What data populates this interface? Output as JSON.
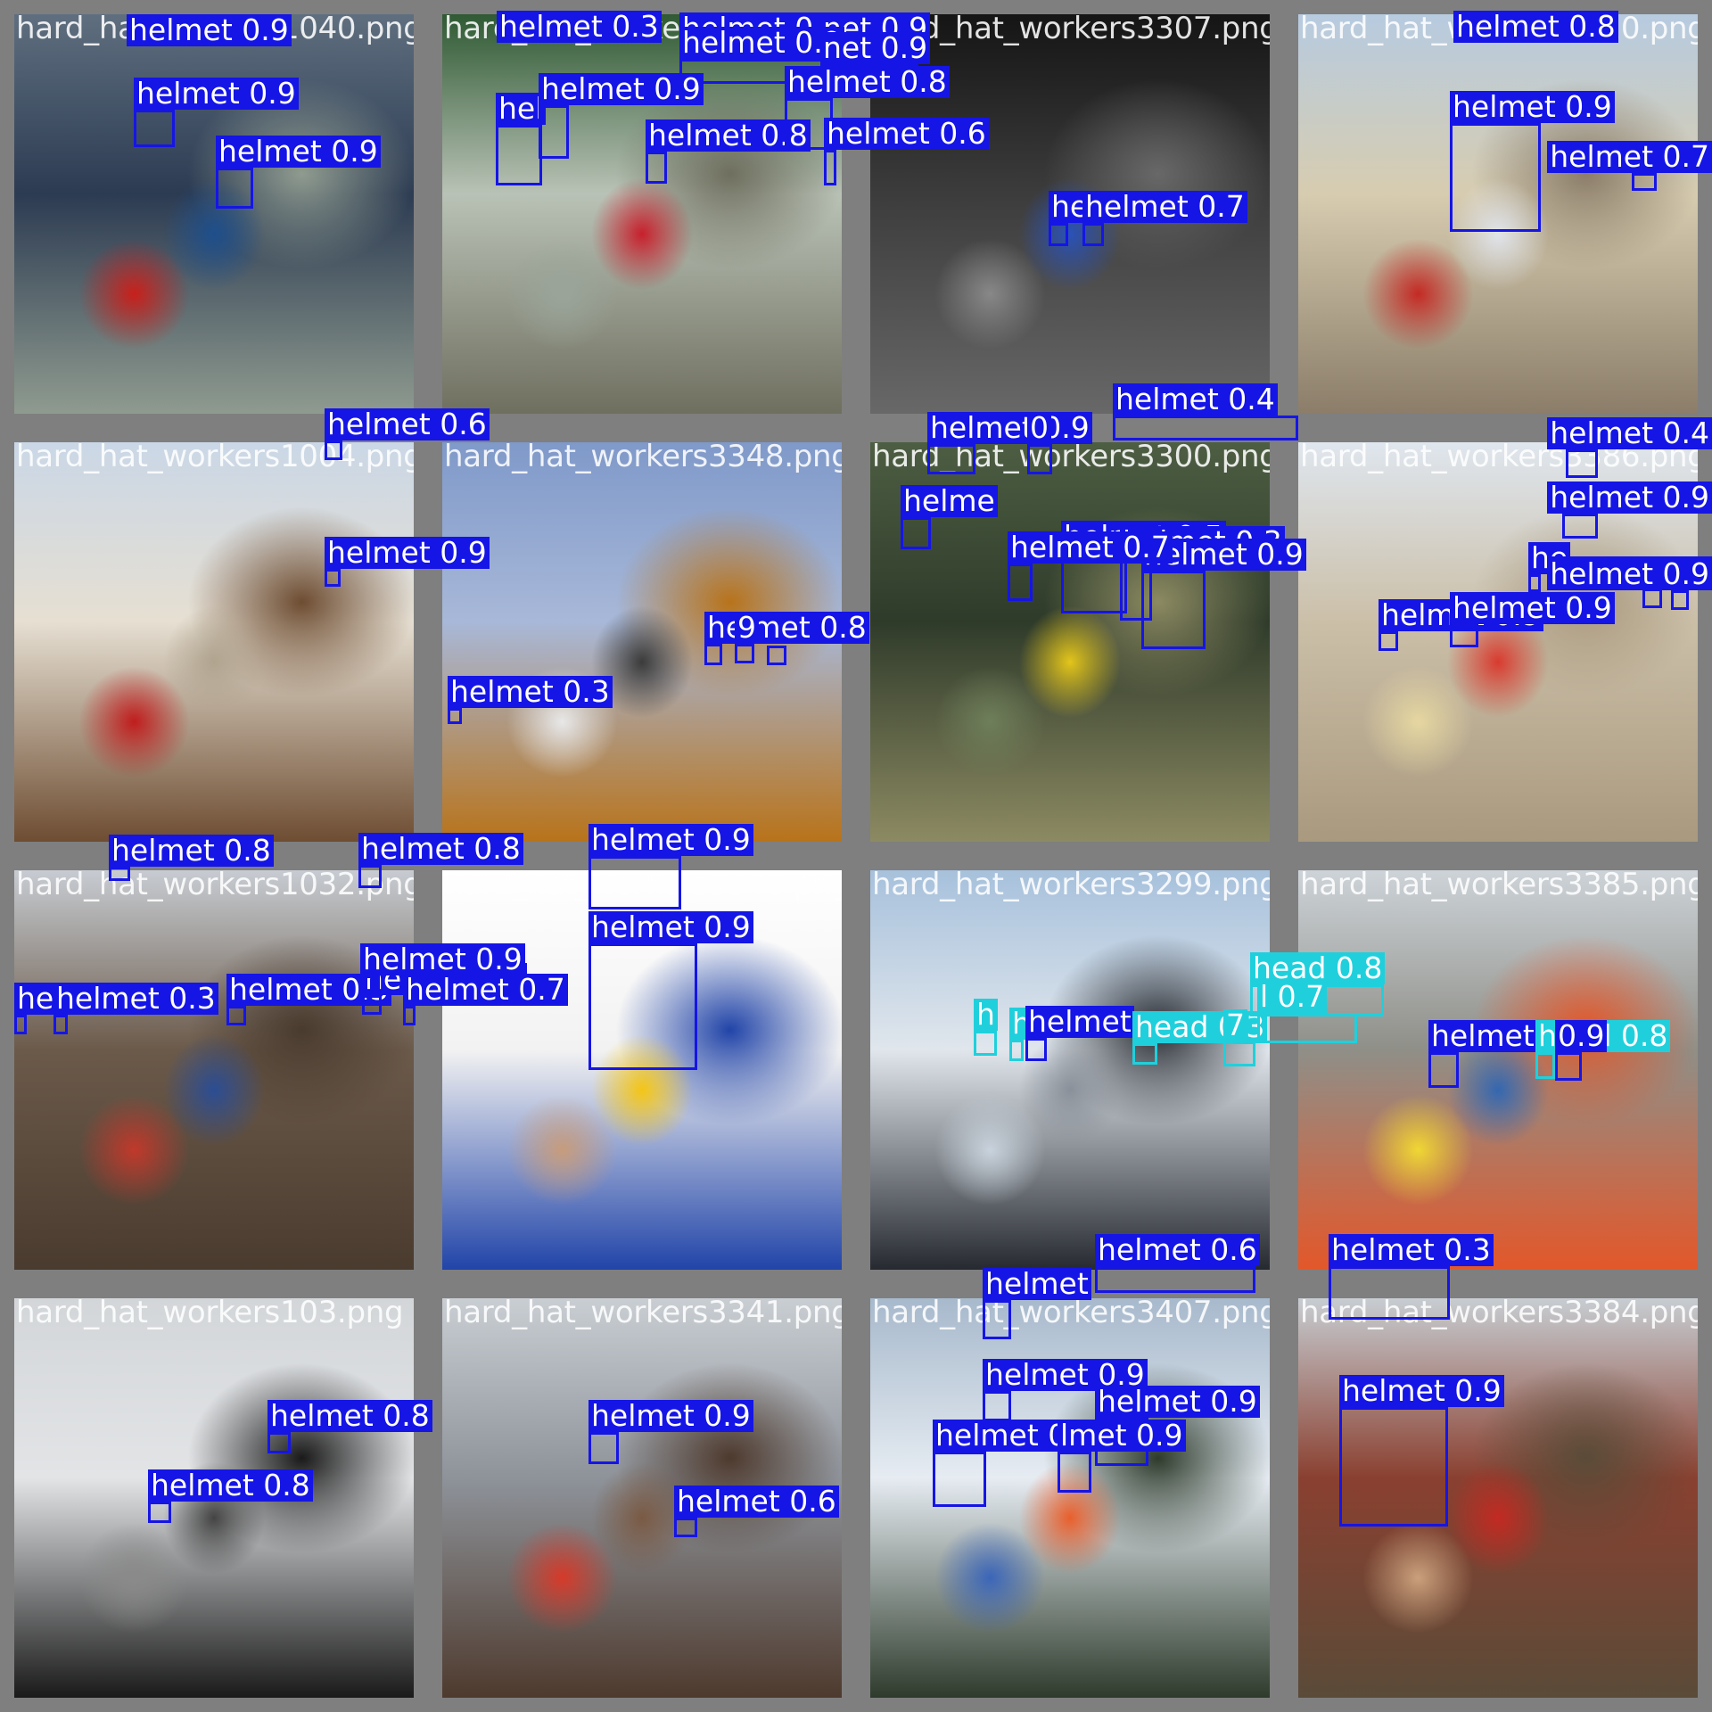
{
  "colors": {
    "helmet": "#1515e6",
    "head": "#1fd0dc",
    "frame": "#7f7f7f"
  },
  "tiles": [
    {
      "file": "hard_hat_workers1040.png",
      "scene": [
        "#5f6f7f",
        "#2c3b52",
        "#8f9b8f",
        "#1e4f8c",
        "#c8201b"
      ]
    },
    {
      "file": "hard_hat_workers1031.png",
      "scene": [
        "#2f5a33",
        "#b9c2b6",
        "#6f6f5f",
        "#c7202c",
        "#9aa59a"
      ]
    },
    {
      "file": "hard_hat_workers3307.png",
      "scene": [
        "#151515",
        "#3c3c3c",
        "#686868",
        "#2a52b8",
        "#888888"
      ]
    },
    {
      "file": "hard_hat_workers3310.png",
      "scene": [
        "#b7cbe0",
        "#d7ccb0",
        "#8b7d69",
        "#dfe3ea",
        "#c42a24"
      ]
    },
    {
      "file": "hard_hat_workers1004.png",
      "scene": [
        "#cad7e6",
        "#e6dfd2",
        "#6e4d32",
        "#b0a48f",
        "#c01d1d"
      ]
    },
    {
      "file": "hard_hat_workers3348.png",
      "scene": [
        "#7f99c9",
        "#a8b8d8",
        "#b8731a",
        "#3b3b3b",
        "#e8e8e8"
      ]
    },
    {
      "file": "hard_hat_workers3300.png",
      "scene": [
        "#4d5e43",
        "#2f3b2a",
        "#8c8a62",
        "#e3c51b",
        "#6e7e5a"
      ]
    },
    {
      "file": "hard_hat_workers3386.png",
      "scene": [
        "#dfe6ee",
        "#cbbfa8",
        "#a9997e",
        "#d83b2f",
        "#e6d7a1"
      ]
    },
    {
      "file": "hard_hat_workers1032.png",
      "scene": [
        "#c7ccd2",
        "#6b5a4a",
        "#4a3b2f",
        "#2b4d93",
        "#c0392b"
      ]
    },
    {
      "file": "hard_hat_workers3346.png",
      "scene": [
        "#ffffff",
        "#f2f2f2",
        "#2144a8",
        "#f3c516",
        "#c79c7c"
      ]
    },
    {
      "file": "hard_hat_workers3299.png",
      "scene": [
        "#a7c1dc",
        "#e0e6ec",
        "#262a30",
        "#8a9099",
        "#c9d3dd"
      ]
    },
    {
      "file": "hard_hat_workers3385.png",
      "scene": [
        "#cdd3d8",
        "#8f8f88",
        "#e3572a",
        "#3467b0",
        "#f0d733"
      ]
    },
    {
      "file": "hard_hat_workers103.png",
      "scene": [
        "#d3d6d9",
        "#e2e4e6",
        "#1a1a1a",
        "#444444",
        "#8a8a8a"
      ]
    },
    {
      "file": "hard_hat_workers3341.png",
      "scene": [
        "#c9ced3",
        "#8e939a",
        "#4e3a2e",
        "#7a5a44",
        "#d63a2a"
      ]
    },
    {
      "file": "hard_hat_workers3407.png",
      "scene": [
        "#a7b9cc",
        "#e6ecf2",
        "#2e3b2c",
        "#e85f2c",
        "#3b66b8"
      ]
    },
    {
      "file": "hard_hat_workers3384.png",
      "scene": [
        "#c7cdd2",
        "#8a4030",
        "#5a4b38",
        "#c22a22",
        "#caa07c"
      ]
    }
  ],
  "detections": [
    {
      "tile": 0,
      "cls": "helmet",
      "label": "helmet 0.9",
      "b": [
        142,
        16,
        174,
        28
      ]
    },
    {
      "tile": 0,
      "cls": "helmet",
      "label": "helmet 0.9",
      "b": [
        150,
        123,
        46,
        42
      ]
    },
    {
      "tile": 0,
      "cls": "helmet",
      "label": "helmet 0.9",
      "b": [
        242,
        188,
        42,
        46
      ]
    },
    {
      "tile": 1,
      "cls": "helmet",
      "label": "helmet 0.3",
      "b": [
        557,
        12,
        180,
        28
      ]
    },
    {
      "tile": 1,
      "cls": "helmet",
      "label": "helmet 0.9",
      "b": [
        762,
        14,
        174,
        28
      ]
    },
    {
      "tile": 1,
      "cls": "helmet",
      "label": "net 0.9",
      "b": [
        920,
        14,
        110,
        28
      ]
    },
    {
      "tile": 1,
      "cls": "helmet",
      "label": "helmet 0.9",
      "b": [
        762,
        66,
        174,
        28
      ]
    },
    {
      "tile": 1,
      "cls": "helmet",
      "label": "net 0.9",
      "b": [
        920,
        72,
        110,
        28
      ]
    },
    {
      "tile": 1,
      "cls": "helmet",
      "label": "hel",
      "b": [
        556,
        140,
        52,
        68
      ]
    },
    {
      "tile": 1,
      "cls": "helmet",
      "label": "helmet 0.9",
      "b": [
        604,
        118,
        34,
        60
      ]
    },
    {
      "tile": 1,
      "cls": "helmet",
      "label": "helmet 0.8",
      "b": [
        724,
        170,
        24,
        36
      ]
    },
    {
      "tile": 1,
      "cls": "helmet",
      "label": "helmet 0.8",
      "b": [
        880,
        110,
        54,
        58
      ]
    },
    {
      "tile": 2,
      "cls": "helmet",
      "label": "helmet 0.6",
      "b": [
        924,
        168,
        14,
        40
      ]
    },
    {
      "tile": 2,
      "cls": "helmet",
      "label": "he",
      "b": [
        1176,
        250,
        22,
        26
      ]
    },
    {
      "tile": 2,
      "cls": "helmet",
      "label": "helmet 0.7",
      "b": [
        1214,
        250,
        24,
        26
      ]
    },
    {
      "tile": 3,
      "cls": "helmet",
      "label": "helmet 0.8",
      "b": [
        1630,
        12,
        180,
        28
      ]
    },
    {
      "tile": 3,
      "cls": "helmet",
      "label": "helmet 0.9",
      "b": [
        1626,
        138,
        102,
        122
      ]
    },
    {
      "tile": 3,
      "cls": "helmet",
      "label": "helmet 0.7",
      "b": [
        1830,
        194,
        28,
        20
      ]
    },
    {
      "tile": 4,
      "cls": "helmet",
      "label": "helmet 0.6",
      "b": [
        364,
        494,
        20,
        22
      ]
    },
    {
      "tile": 4,
      "cls": "helmet",
      "label": "helmet 0.9",
      "b": [
        364,
        638,
        18,
        20
      ]
    },
    {
      "tile": 5,
      "cls": "helmet",
      "label": "helmet 0.3",
      "b": [
        502,
        794,
        16,
        18
      ]
    },
    {
      "tile": 5,
      "cls": "helmet",
      "label": "helmet 0.8",
      "b": [
        790,
        722,
        20,
        24
      ]
    },
    {
      "tile": 5,
      "cls": "helmet",
      "label": "9",
      "b": [
        824,
        722,
        22,
        22
      ]
    },
    {
      "tile": 5,
      "cls": "helmet",
      "label": "",
      "b": [
        860,
        724,
        22,
        22
      ]
    },
    {
      "tile": 6,
      "cls": "helmet",
      "label": "helmet 0.9",
      "b": [
        1040,
        498,
        54,
        34
      ]
    },
    {
      "tile": 6,
      "cls": "helmet",
      "label": "0",
      "b": [
        1152,
        498,
        28,
        34
      ]
    },
    {
      "tile": 6,
      "cls": "helmet",
      "label": "helmet 0.4",
      "b": [
        1248,
        466,
        208,
        28
      ]
    },
    {
      "tile": 6,
      "cls": "helmet",
      "label": "helme",
      "b": [
        1010,
        580,
        34,
        36
      ]
    },
    {
      "tile": 6,
      "cls": "helmet",
      "label": "helmet 0.5",
      "b": [
        1190,
        620,
        74,
        68
      ]
    },
    {
      "tile": 6,
      "cls": "helmet",
      "label": "helmet 0.3",
      "b": [
        1256,
        626,
        36,
        70
      ]
    },
    {
      "tile": 6,
      "cls": "helmet",
      "label": "helmet 0.9",
      "b": [
        1280,
        640,
        72,
        88
      ]
    },
    {
      "tile": 6,
      "cls": "helmet",
      "label": "helmet 0.7",
      "b": [
        1130,
        632,
        28,
        42
      ]
    },
    {
      "tile": 7,
      "cls": "helmet",
      "label": "helmet 0.4",
      "b": [
        1756,
        504,
        36,
        32
      ]
    },
    {
      "tile": 7,
      "cls": "helmet",
      "label": "helmet 0.9",
      "b": [
        1752,
        576,
        40,
        28
      ]
    },
    {
      "tile": 7,
      "cls": "helmet",
      "label": "he",
      "b": [
        1714,
        644,
        14,
        20
      ]
    },
    {
      "tile": 7,
      "cls": "helmet",
      "label": "helmet 0.7",
      "b": [
        1842,
        660,
        22,
        22
      ]
    },
    {
      "tile": 7,
      "cls": "helmet",
      "label": "helmet 0.9",
      "b": [
        1546,
        708,
        22,
        22
      ]
    },
    {
      "tile": 7,
      "cls": "helmet",
      "label": "helmet 0.9",
      "b": [
        1626,
        700,
        32,
        26
      ]
    },
    {
      "tile": 7,
      "cls": "helmet",
      "label": "helmet 0.9",
      "b": [
        1874,
        662,
        20,
        22
      ]
    },
    {
      "tile": 8,
      "cls": "helmet",
      "label": "helmet 0.8",
      "b": [
        122,
        972,
        24,
        16
      ]
    },
    {
      "tile": 8,
      "cls": "helmet",
      "label": "helmet 0.8",
      "b": [
        402,
        970,
        26,
        26
      ]
    },
    {
      "tile": 8,
      "cls": "helmet",
      "label": "helmet 0.3",
      "b": [
        254,
        1128,
        22,
        22
      ]
    },
    {
      "tile": 8,
      "cls": "helmet",
      "label": "he",
      "b": [
        16,
        1138,
        14,
        22
      ]
    },
    {
      "tile": 8,
      "cls": "helmet",
      "label": "helmet 0.3",
      "b": [
        60,
        1138,
        16,
        22
      ]
    },
    {
      "tile": 8,
      "cls": "helmet",
      "label": "helmet 0.8",
      "b": [
        406,
        1116,
        22,
        22
      ]
    },
    {
      "tile": 8,
      "cls": "helmet",
      "label": "helmet 0.9",
      "b": [
        404,
        1094,
        22,
        22
      ]
    },
    {
      "tile": 8,
      "cls": "helmet",
      "label": "helmet 0.7",
      "b": [
        452,
        1128,
        14,
        22
      ]
    },
    {
      "tile": 9,
      "cls": "helmet",
      "label": "helmet 0.9",
      "b": [
        660,
        960,
        104,
        60
      ]
    },
    {
      "tile": 9,
      "cls": "helmet",
      "label": "helmet 0.9",
      "b": [
        660,
        1058,
        122,
        142
      ]
    },
    {
      "tile": 10,
      "cls": "head",
      "label": "h",
      "b": [
        1092,
        1156,
        26,
        28
      ]
    },
    {
      "tile": 10,
      "cls": "head",
      "label": "h",
      "b": [
        1132,
        1166,
        16,
        24
      ]
    },
    {
      "tile": 10,
      "cls": "helmet",
      "label": "helmet",
      "b": [
        1150,
        1164,
        24,
        26
      ]
    },
    {
      "tile": 10,
      "cls": "head",
      "label": "head 0.3",
      "b": [
        1270,
        1170,
        28,
        24
      ]
    },
    {
      "tile": 10,
      "cls": "head",
      "label": "7",
      "b": [
        1372,
        1168,
        36,
        28
      ]
    },
    {
      "tile": 10,
      "cls": "head",
      "label": "head 0.8",
      "b": [
        1402,
        1104,
        150,
        36
      ]
    },
    {
      "tile": 10,
      "cls": "head",
      "label": "l 0.7",
      "b": [
        1410,
        1136,
        112,
        34
      ]
    },
    {
      "tile": 11,
      "cls": "helmet",
      "label": "helmet",
      "b": [
        1602,
        1180,
        34,
        40
      ]
    },
    {
      "tile": 11,
      "cls": "head",
      "label": "head 0.8",
      "b": [
        1722,
        1180,
        22,
        30
      ]
    },
    {
      "tile": 11,
      "cls": "helmet",
      "label": "0.9",
      "b": [
        1744,
        1180,
        30,
        32
      ]
    },
    {
      "tile": 12,
      "cls": "helmet",
      "label": "helmet 0.8",
      "b": [
        300,
        1606,
        26,
        24
      ]
    },
    {
      "tile": 12,
      "cls": "helmet",
      "label": "helmet 0.8",
      "b": [
        166,
        1684,
        26,
        24
      ]
    },
    {
      "tile": 13,
      "cls": "helmet",
      "label": "helmet 0.9",
      "b": [
        660,
        1606,
        34,
        36
      ]
    },
    {
      "tile": 13,
      "cls": "helmet",
      "label": "helmet 0.6",
      "b": [
        756,
        1702,
        26,
        22
      ]
    },
    {
      "tile": 14,
      "cls": "helmet",
      "label": "helmet",
      "b": [
        1102,
        1458,
        32,
        44
      ]
    },
    {
      "tile": 14,
      "cls": "helmet",
      "label": "helmet 0.6",
      "b": [
        1228,
        1420,
        180,
        30
      ]
    },
    {
      "tile": 14,
      "cls": "helmet",
      "label": "helmet 0.9",
      "b": [
        1102,
        1560,
        32,
        34
      ]
    },
    {
      "tile": 14,
      "cls": "helmet",
      "label": "helmet 0.9",
      "b": [
        1228,
        1590,
        60,
        54
      ]
    },
    {
      "tile": 14,
      "cls": "helmet",
      "label": "helmet 0.7",
      "b": [
        1046,
        1628,
        60,
        62
      ]
    },
    {
      "tile": 14,
      "cls": "helmet",
      "label": "lmet 0.9",
      "b": [
        1186,
        1628,
        38,
        46
      ]
    },
    {
      "tile": 15,
      "cls": "helmet",
      "label": "helmet 0.3",
      "b": [
        1490,
        1420,
        136,
        60
      ]
    },
    {
      "tile": 15,
      "cls": "helmet",
      "label": "helmet 0.9",
      "b": [
        1502,
        1578,
        122,
        134
      ]
    }
  ]
}
